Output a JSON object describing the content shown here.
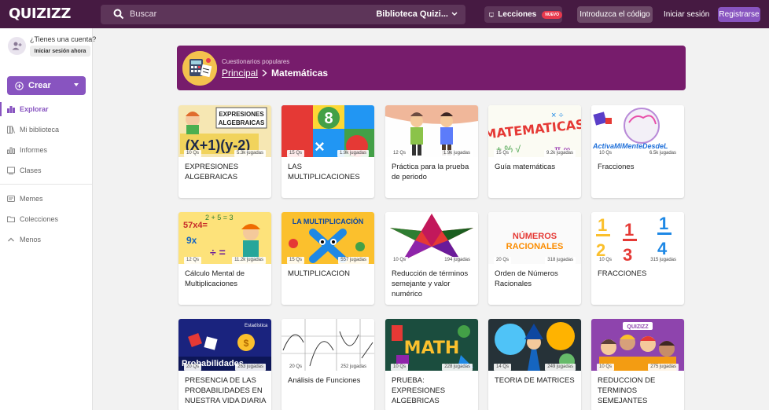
{
  "header": {
    "logo": "QUIZIZZ",
    "search_placeholder": "Buscar",
    "library_select": "Biblioteca Quizi...",
    "lessons_label": "Lecciones",
    "lessons_badge": "NUEVO",
    "code_button": "Introduzca el código",
    "login_link": "Iniciar sesión",
    "register_button": "Registrarse"
  },
  "sidebar": {
    "account_question": "¿Tienes una cuenta?",
    "account_button": "Iniciar sesión ahora",
    "create_button": "Crear",
    "items": [
      {
        "label": "Explorar",
        "icon": "explore-icon",
        "active": true
      },
      {
        "label": "Mi biblioteca",
        "icon": "library-icon",
        "active": false
      },
      {
        "label": "Informes",
        "icon": "reports-icon",
        "active": false
      },
      {
        "label": "Clases",
        "icon": "classes-icon",
        "active": false
      }
    ],
    "items2": [
      {
        "label": "Memes",
        "icon": "memes-icon"
      },
      {
        "label": "Colecciones",
        "icon": "folder-icon"
      },
      {
        "label": "Menos",
        "icon": "chevron-up-icon"
      }
    ]
  },
  "banner": {
    "subtitle": "Cuestionarios populares",
    "crumb": "Principal",
    "current": "Matemáticas"
  },
  "cards": [
    {
      "title": "EXPRESIONES ALGEBRAICAS",
      "qs": "10 Qs",
      "plays": "5.3k jugadas",
      "thumb": "algebra"
    },
    {
      "title": "LAS MULTIPLICACIONES",
      "qs": "15 Qs",
      "plays": "1.9k jugadas",
      "thumb": "mult8"
    },
    {
      "title": "Práctica para la prueba de periodo",
      "qs": "12 Qs",
      "plays": "1.9k jugadas",
      "thumb": "kids"
    },
    {
      "title": "Guía matemáticas",
      "qs": "15 Qs",
      "plays": "9.2k jugadas",
      "thumb": "matematicas"
    },
    {
      "title": "Fracciones",
      "qs": "10 Qs",
      "plays": "6.5k jugadas",
      "thumb": "activa"
    },
    {
      "title": "Cálculo Mental de Multiplicaciones",
      "qs": "12 Qs",
      "plays": "11.2k jugadas",
      "thumb": "calculo"
    },
    {
      "title": "MULTIPLICACION",
      "qs": "15 Qs",
      "plays": "557 jugadas",
      "thumb": "lamult"
    },
    {
      "title": "Reducción de términos semejante y valor numérico",
      "qs": "10 Qs",
      "plays": "194 jugadas",
      "thumb": "star"
    },
    {
      "title": "Orden de Números Racionales",
      "qs": "20 Qs",
      "plays": "318 jugadas",
      "thumb": "racionales"
    },
    {
      "title": "FRACCIONES",
      "qs": "10 Qs",
      "plays": "315 jugadas",
      "thumb": "fracs"
    },
    {
      "title": "PRESENCIA DE LAS PROBABILIDADES EN NUESTRA VIDA DIARIA",
      "qs": "20 Qs",
      "plays": "263 jugadas",
      "thumb": "prob"
    },
    {
      "title": "Análisis de Funciones",
      "qs": "20 Qs",
      "plays": "252 jugadas",
      "thumb": "graphs"
    },
    {
      "title": "PRUEBA: EXPRESIONES ALGEBRICAS",
      "qs": "10 Qs",
      "plays": "228 jugadas",
      "thumb": "math"
    },
    {
      "title": "TEORIA DE MATRICES",
      "qs": "14 Qs",
      "plays": "249 jugadas",
      "thumb": "anime"
    },
    {
      "title": "REDUCCION DE TERMINOS SEMEJANTES",
      "qs": "10 Qs",
      "plays": "275 jugadas",
      "thumb": "quizizzkids"
    }
  ],
  "thumb_text": {
    "algebra_top": "EXPRESIONES",
    "algebra_mid": "ALGEBRAICAS",
    "algebra_eq": "(X+1)(y-2)",
    "mult8_num": "8",
    "matematicas": "MATEMATICAS",
    "activa": "ActivaMiMenteDesdeL",
    "calc_a": "57x4=",
    "calc_b": "9x",
    "lamult": "LA MULTIPLICACIÓN",
    "rac_top": "NÚMEROS",
    "rac_bot": "RACIONALES",
    "frac_1": "1",
    "frac_2": "2",
    "frac_3": "3",
    "frac_4": "4",
    "prob_top": "Estadística",
    "prob_main": "Probabilidades",
    "math": "MATH",
    "quizizz": "QUIZIZZ"
  },
  "colors": {
    "header_bg": "#461a42",
    "accent": "#8854c0",
    "banner_bg": "#771c6c",
    "badge": "#e8394d"
  }
}
